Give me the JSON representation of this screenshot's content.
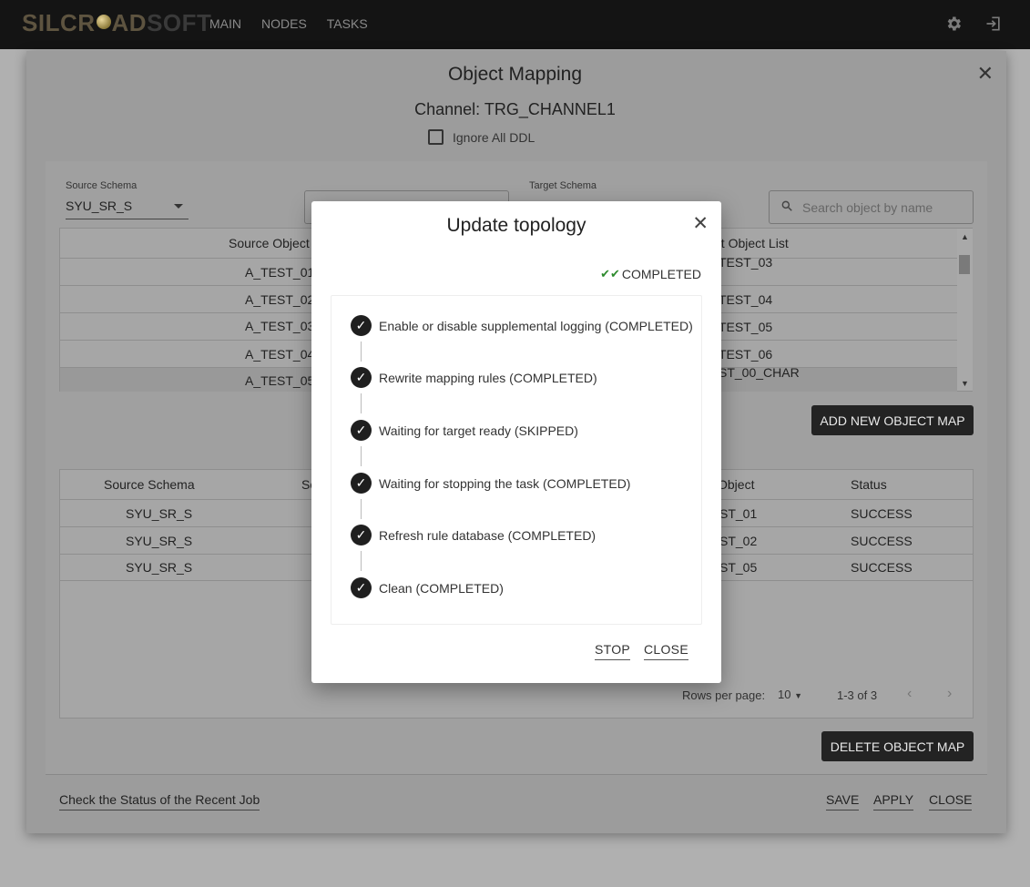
{
  "topbar": {
    "logo_text_a": "SILCR",
    "logo_text_b": "AD",
    "logo_text_c": "SOFT",
    "nav": [
      "MAIN",
      "NODES",
      "TASKS"
    ],
    "icons": [
      "gear-icon",
      "logout-icon"
    ]
  },
  "mapping": {
    "title": "Object Mapping",
    "channel": "Channel: TRG_CHANNEL1",
    "ignore_ddl_label": "Ignore All DDL",
    "source_schema_label": "Source Schema",
    "source_schema_value": "SYU_SR_S",
    "target_schema_label": "Target Schema",
    "search_placeholder": "Search object by name",
    "source_list_header": "Source Object L",
    "target_list_header": "et Object List",
    "source_rows": [
      "A_TEST_01",
      "A_TEST_02",
      "A_TEST_03",
      "A_TEST_04",
      "A_TEST_05"
    ],
    "target_rows": [
      "TEST_03",
      "TEST_04",
      "TEST_05",
      "TEST_06",
      "ST_00_CHAR"
    ],
    "add_button": "ADD NEW OBJECT MAP",
    "map_table": {
      "headers": [
        "Source Schema",
        "So",
        "Object",
        "Status"
      ],
      "rows": [
        {
          "schema": "SYU_SR_S",
          "object": "ST_01",
          "status": "SUCCESS"
        },
        {
          "schema": "SYU_SR_S",
          "object": "ST_02",
          "status": "SUCCESS"
        },
        {
          "schema": "SYU_SR_S",
          "object": "ST_05",
          "status": "SUCCESS"
        }
      ]
    },
    "rows_per_page_label": "Rows per page:",
    "rows_per_page_value": "10",
    "page_range": "1-3 of 3",
    "delete_button": "DELETE OBJECT MAP",
    "recent_job_link": "Check the Status of the Recent Job",
    "save": "SAVE",
    "apply": "APPLY",
    "close": "CLOSE"
  },
  "topology": {
    "title": "Update topology",
    "status": "COMPLETED",
    "steps": [
      "Enable or disable supplemental logging (COMPLETED)",
      "Rewrite mapping rules (COMPLETED)",
      "Waiting for target ready (SKIPPED)",
      "Waiting for stopping the task (COMPLETED)",
      "Refresh rule database (COMPLETED)",
      "Clean (COMPLETED)"
    ],
    "stop": "STOP",
    "close": "CLOSE"
  }
}
